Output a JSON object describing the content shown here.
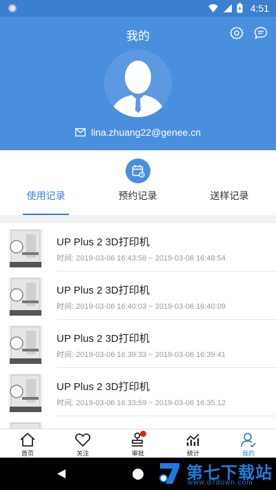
{
  "status_bar": {
    "time": "4:51"
  },
  "header": {
    "title": "我的",
    "email": "lina.zhuang22@genee.cn"
  },
  "tabs": [
    {
      "label": "使用记录",
      "active": true
    },
    {
      "label": "预约记录",
      "active": false
    },
    {
      "label": "送样记录",
      "active": false
    }
  ],
  "records": [
    {
      "name": "UP Plus 2 3D打印机",
      "time": "时间:  2019-03-06 16:43:58 ~ 2019-03-06 16:48:54"
    },
    {
      "name": "UP Plus 2 3D打印机",
      "time": "时间:  2019-03-06 16:40:03 ~ 2019-03-06 16:40:09"
    },
    {
      "name": "UP Plus 2 3D打印机",
      "time": "时间:  2019-03-06 16:39:33 ~ 2019-03-06 16:39:41"
    },
    {
      "name": "UP Plus 2 3D打印机",
      "time": "时间:  2019-03-06 16:33:59 ~ 2019-03-06 16:35:12"
    }
  ],
  "bottom_nav": [
    {
      "label": "首页",
      "icon": "home-icon"
    },
    {
      "label": "关注",
      "icon": "heart-icon"
    },
    {
      "label": "审批",
      "icon": "stamp-icon",
      "badge": true
    },
    {
      "label": "统计",
      "icon": "stats-icon"
    },
    {
      "label": "我的",
      "icon": "profile-icon",
      "active": true
    }
  ],
  "watermark": {
    "title": "第七下载站",
    "url": "www.d7down.com"
  },
  "colors": {
    "primary": "#4a8fde",
    "accent": "#3a7fd0",
    "badge": "#e02020"
  }
}
